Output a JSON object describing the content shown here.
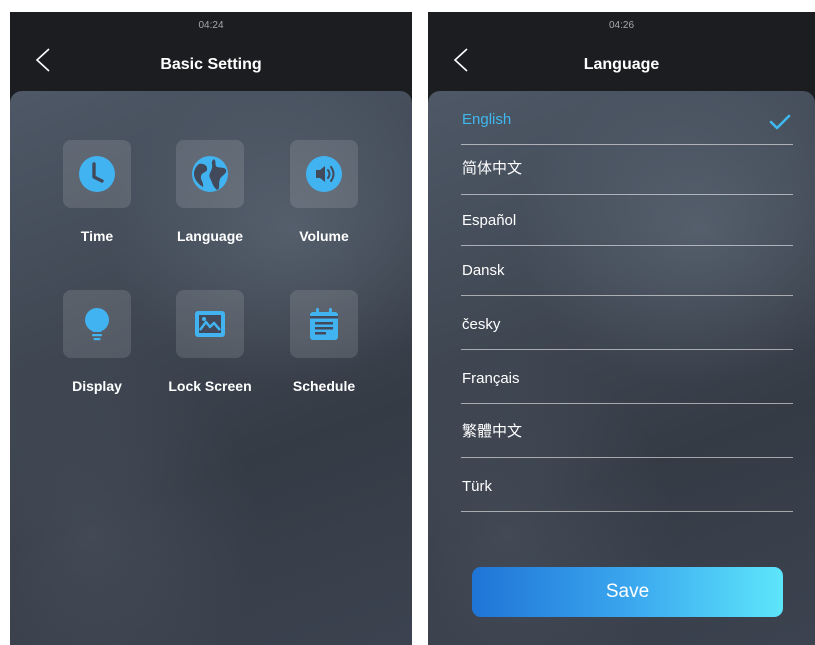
{
  "basic_setting": {
    "status_time": "04:24",
    "title": "Basic Setting",
    "items": [
      {
        "label": "Time",
        "icon": "clock-icon"
      },
      {
        "label": "Language",
        "icon": "globe-icon"
      },
      {
        "label": "Volume",
        "icon": "speaker-icon"
      },
      {
        "label": "Display",
        "icon": "lightbulb-icon"
      },
      {
        "label": "Lock Screen",
        "icon": "image-icon"
      },
      {
        "label": "Schedule",
        "icon": "calendar-icon"
      }
    ]
  },
  "language_screen": {
    "status_time": "04:26",
    "title": "Language",
    "selected": "English",
    "options": [
      "English",
      "简体中文",
      "Español",
      "Dansk",
      "česky",
      "Français",
      "繁體中文",
      "Türk"
    ],
    "save_label": "Save"
  },
  "colors": {
    "accent": "#3fb8ef",
    "icon_blue": "#42b3f1",
    "header_bg": "#1c1d21"
  }
}
